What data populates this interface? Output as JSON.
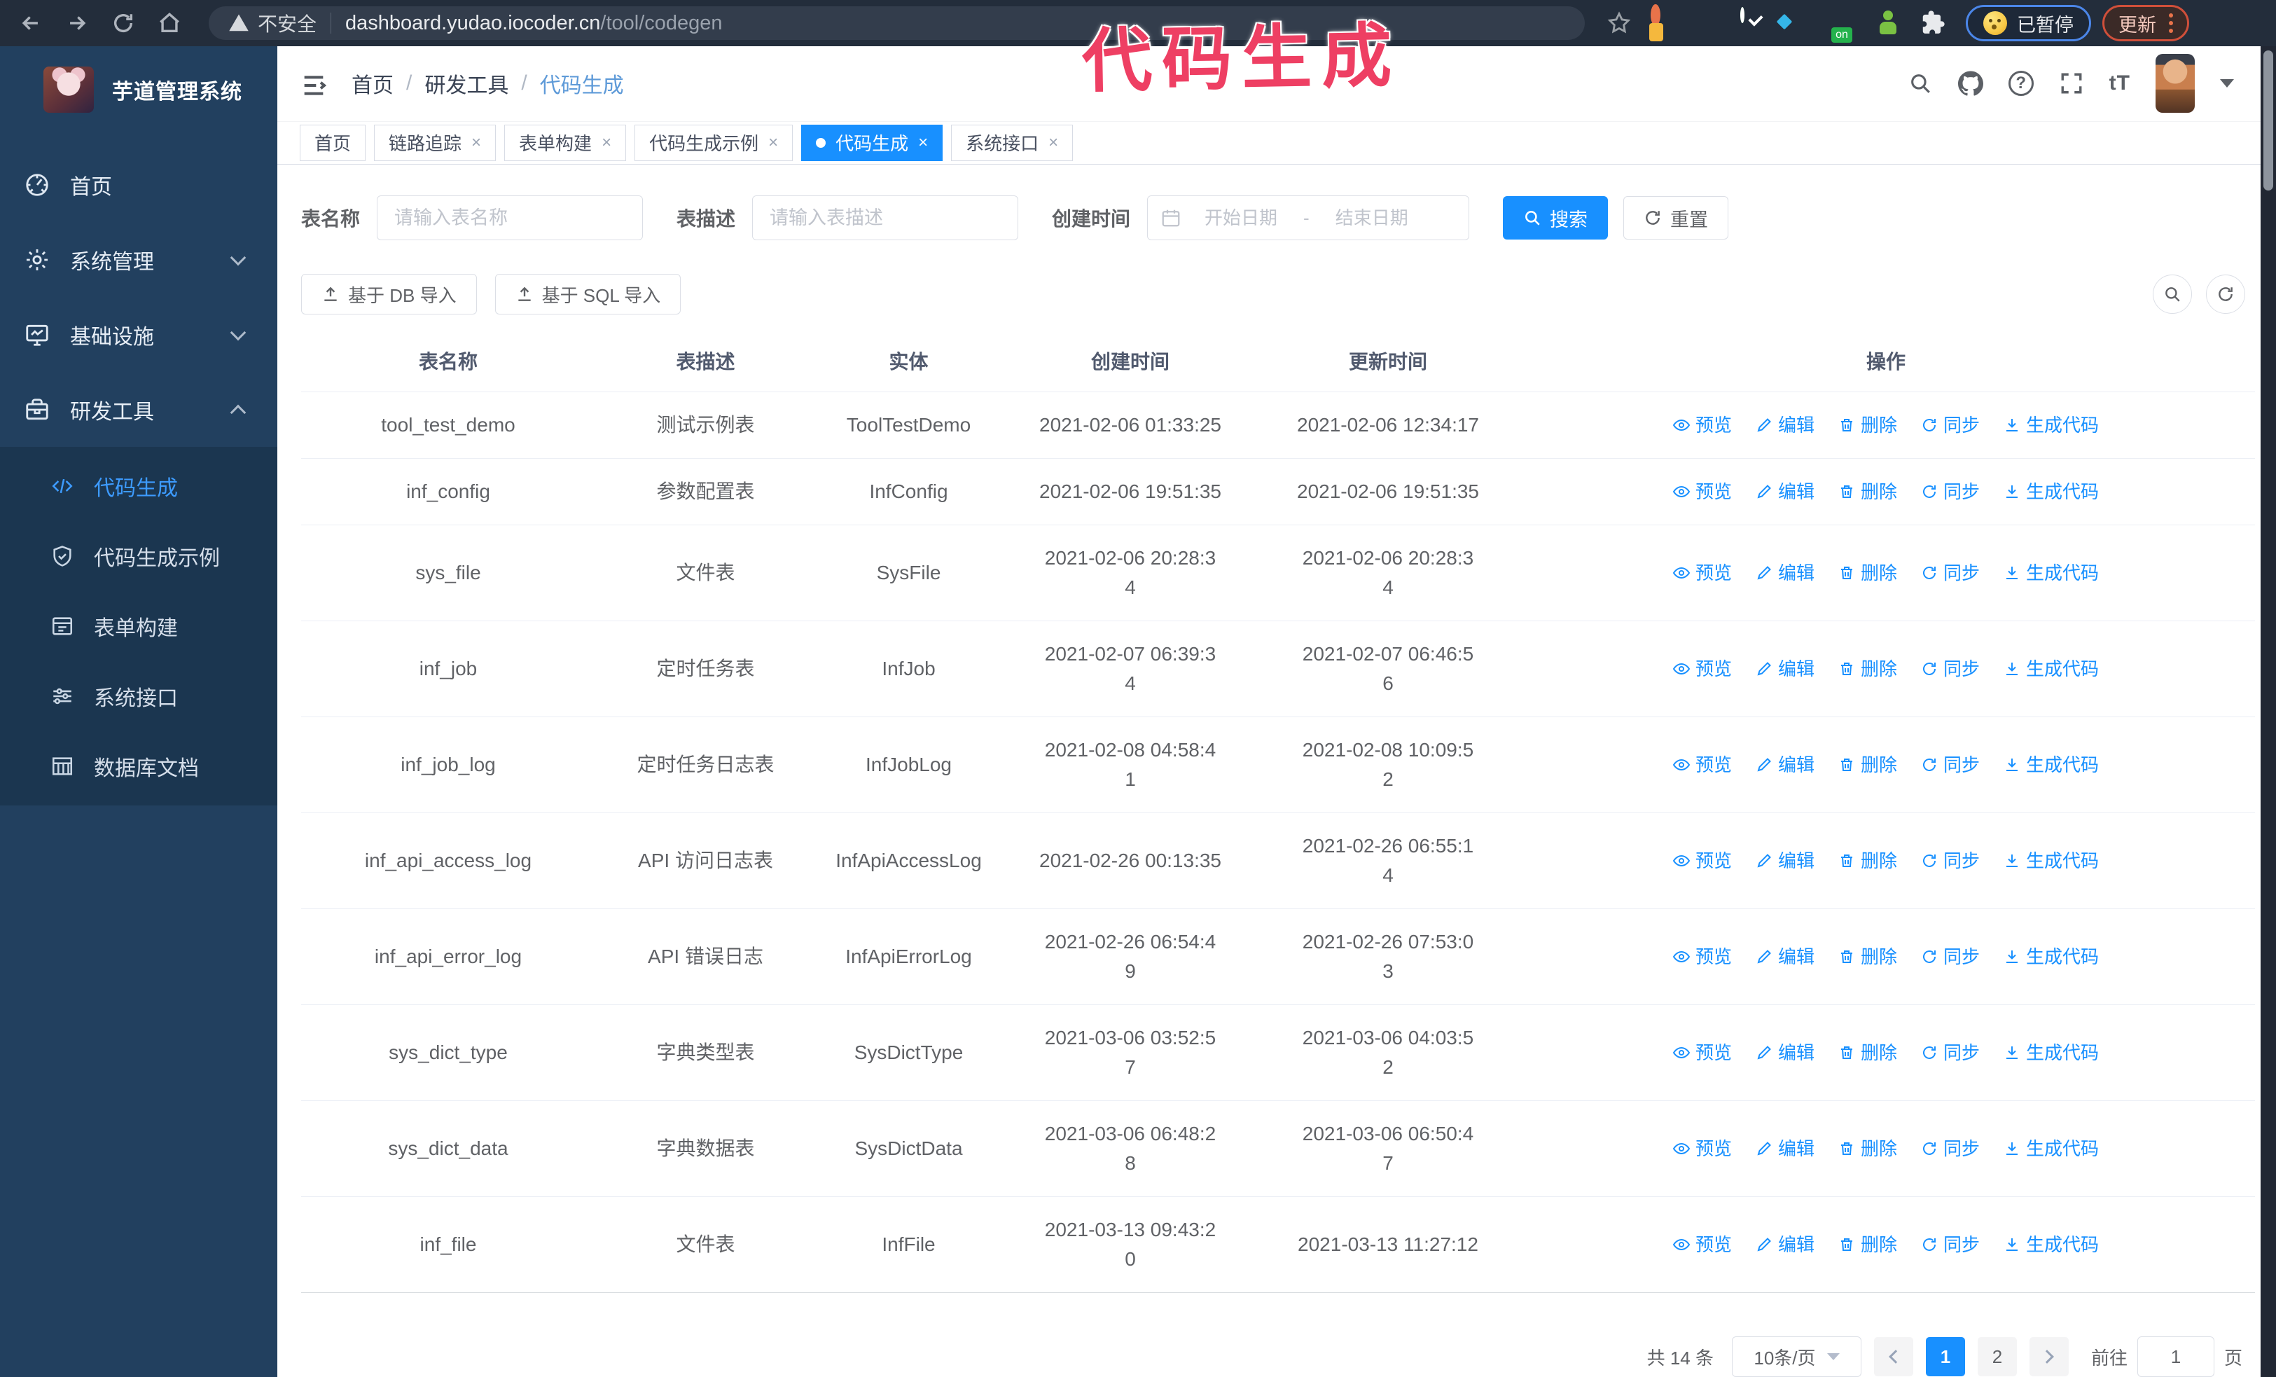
{
  "browser": {
    "security_label": "不安全",
    "url_host": "dashboard.yudao.iocoder.cn",
    "url_path": "/tool/codegen",
    "paused_label": "已暂停",
    "update_label": "更新",
    "ext_on_badge": "on"
  },
  "annotation": {
    "text": "代码生成",
    "color": "#ee3f63"
  },
  "sidebar": {
    "title": "芋道管理系统",
    "items": [
      {
        "label": "首页"
      },
      {
        "label": "系统管理"
      },
      {
        "label": "基础设施"
      },
      {
        "label": "研发工具"
      }
    ],
    "submenu": [
      {
        "label": "代码生成"
      },
      {
        "label": "代码生成示例"
      },
      {
        "label": "表单构建"
      },
      {
        "label": "系统接口"
      },
      {
        "label": "数据库文档"
      }
    ]
  },
  "header": {
    "breadcrumb": [
      "首页",
      "研发工具",
      "代码生成"
    ],
    "breadcrumb_separator": "/"
  },
  "tabs": [
    {
      "label": "首页"
    },
    {
      "label": "链路追踪"
    },
    {
      "label": "表单构建"
    },
    {
      "label": "代码生成示例"
    },
    {
      "label": "代码生成"
    },
    {
      "label": "系统接口"
    }
  ],
  "filters": {
    "table_name_label": "表名称",
    "table_name_placeholder": "请输入表名称",
    "table_desc_label": "表描述",
    "table_desc_placeholder": "请输入表描述",
    "create_time_label": "创建时间",
    "start_placeholder": "开始日期",
    "range_separator": "-",
    "end_placeholder": "结束日期",
    "search_label": "搜索",
    "reset_label": "重置"
  },
  "toolbar": {
    "import_db_label": "基于 DB 导入",
    "import_sql_label": "基于 SQL 导入"
  },
  "table": {
    "columns": [
      "表名称",
      "表描述",
      "实体",
      "创建时间",
      "更新时间",
      "操作"
    ],
    "actions": [
      "预览",
      "编辑",
      "删除",
      "同步",
      "生成代码"
    ],
    "rows": [
      {
        "name": "tool_test_demo",
        "description": "测试示例表",
        "entity": "ToolTestDemo",
        "create_time": "2021-02-06 01:33:25",
        "update_time": "2021-02-06 12:34:17"
      },
      {
        "name": "inf_config",
        "description": "参数配置表",
        "entity": "InfConfig",
        "create_time": "2021-02-06 19:51:35",
        "update_time": "2021-02-06 19:51:35"
      },
      {
        "name": "sys_file",
        "description": "文件表",
        "entity": "SysFile",
        "create_time": "2021-02-06 20:28:3\n4",
        "update_time": "2021-02-06 20:28:3\n4"
      },
      {
        "name": "inf_job",
        "description": "定时任务表",
        "entity": "InfJob",
        "create_time": "2021-02-07 06:39:3\n4",
        "update_time": "2021-02-07 06:46:5\n6"
      },
      {
        "name": "inf_job_log",
        "description": "定时任务日志表",
        "entity": "InfJobLog",
        "create_time": "2021-02-08 04:58:4\n1",
        "update_time": "2021-02-08 10:09:5\n2"
      },
      {
        "name": "inf_api_access_log",
        "description": "API 访问日志表",
        "entity": "InfApiAccessLog",
        "create_time": "2021-02-26 00:13:35",
        "update_time": "2021-02-26 06:55:1\n4"
      },
      {
        "name": "inf_api_error_log",
        "description": "API 错误日志",
        "entity": "InfApiErrorLog",
        "create_time": "2021-02-26 06:54:4\n9",
        "update_time": "2021-02-26 07:53:0\n3"
      },
      {
        "name": "sys_dict_type",
        "description": "字典类型表",
        "entity": "SysDictType",
        "create_time": "2021-03-06 03:52:5\n7",
        "update_time": "2021-03-06 04:03:5\n2"
      },
      {
        "name": "sys_dict_data",
        "description": "字典数据表",
        "entity": "SysDictData",
        "create_time": "2021-03-06 06:48:2\n8",
        "update_time": "2021-03-06 06:50:4\n7"
      },
      {
        "name": "inf_file",
        "description": "文件表",
        "entity": "InfFile",
        "create_time": "2021-03-13 09:43:2\n0",
        "update_time": "2021-03-13 11:27:12"
      }
    ]
  },
  "pagination": {
    "total_label": "共 14 条",
    "page_size_label": "10条/页",
    "pages": [
      "1",
      "2"
    ],
    "goto_label": "前往",
    "goto_value": "1",
    "goto_suffix": "页"
  },
  "ui": {
    "close_glyph": "×",
    "question_glyph": "?",
    "font_size_label": "tT"
  },
  "colors": {
    "primary": "#1890ff",
    "sidebar_bg": "#22405f",
    "submenu_bg": "#1b3650",
    "browser_bg": "#232d3b",
    "annotation": "#ee3f63"
  }
}
